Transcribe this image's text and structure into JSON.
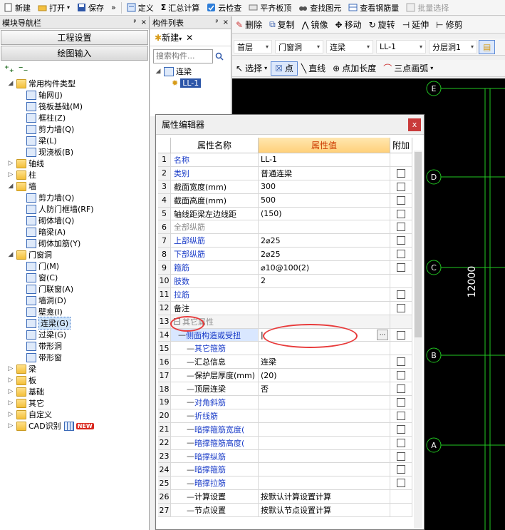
{
  "toolbar": {
    "new": "新建",
    "open": "打开",
    "save": "保存",
    "more": "»",
    "define": "定义",
    "sum": "汇总计算",
    "cloud_check": "云检查",
    "flat_top": "平齐板顶",
    "find_element": "查找图元",
    "view_rebar": "查看钢筋量",
    "batch_select": "批量选择"
  },
  "nav_panel": {
    "title": "模块导航栏",
    "pin": "ᵖ",
    "close": "×",
    "project_settings": "工程设置",
    "drawing_input": "绘图输入"
  },
  "tree": [
    {
      "label": "常用构件类型",
      "expanded": true,
      "folder": true,
      "children": [
        {
          "label": "轴网(J)"
        },
        {
          "label": "筏板基础(M)"
        },
        {
          "label": "框柱(Z)"
        },
        {
          "label": "剪力墙(Q)"
        },
        {
          "label": "梁(L)"
        },
        {
          "label": "现浇板(B)"
        }
      ]
    },
    {
      "label": "轴线",
      "folder": true
    },
    {
      "label": "柱",
      "folder": true
    },
    {
      "label": "墙",
      "expanded": true,
      "folder": true,
      "children": [
        {
          "label": "剪力墙(Q)"
        },
        {
          "label": "人防门框墙(RF)"
        },
        {
          "label": "砌体墙(Q)"
        },
        {
          "label": "暗梁(A)"
        },
        {
          "label": "砌体加筋(Y)"
        }
      ]
    },
    {
      "label": "门窗洞",
      "expanded": true,
      "folder": true,
      "children": [
        {
          "label": "门(M)"
        },
        {
          "label": "窗(C)"
        },
        {
          "label": "门联窗(A)"
        },
        {
          "label": "墙洞(D)"
        },
        {
          "label": "壁龛(I)"
        },
        {
          "label": "连梁(G)",
          "selected": true
        },
        {
          "label": "过梁(G)"
        },
        {
          "label": "带形洞"
        },
        {
          "label": "带形窗"
        }
      ]
    },
    {
      "label": "梁",
      "folder": true
    },
    {
      "label": "板",
      "folder": true
    },
    {
      "label": "基础",
      "folder": true
    },
    {
      "label": "其它",
      "folder": true
    },
    {
      "label": "自定义",
      "folder": true
    },
    {
      "label": "CAD识别",
      "folder": true,
      "new_badge": "NEW"
    }
  ],
  "comp_panel": {
    "title": "构件列表",
    "new": "新建",
    "delete": "✕",
    "search_placeholder": "搜索构件...",
    "tree_root": "连梁",
    "tree_child": "LL-1"
  },
  "right_toolbar_1": {
    "delete": "删除",
    "copy": "复制",
    "mirror": "镜像",
    "move": "移动",
    "rotate": "旋转",
    "extend": "延伸",
    "trim": "修剪"
  },
  "right_toolbar_2": {
    "floor": "首层",
    "type": "门窗洞",
    "sub": "连梁",
    "member": "LL-1",
    "layer": "分层洞1"
  },
  "right_toolbar_3": {
    "select": "选择",
    "point": "点",
    "line": "直线",
    "point_length": "点加长度",
    "three_point_arc": "三点画弧"
  },
  "canvas": {
    "axes": [
      "E",
      "D",
      "C",
      "B",
      "A"
    ],
    "dimension": "12000",
    "colors": {
      "background": "#000000",
      "grid": "#22c722",
      "text": "#ffffff"
    }
  },
  "prop_editor": {
    "title": "属性编辑器",
    "close": "x",
    "headers": {
      "name": "属性名称",
      "value": "属性值",
      "add": "附加"
    },
    "rows": [
      {
        "n": "1",
        "name": "名称",
        "value": "LL-1",
        "style": "blue",
        "chk": false
      },
      {
        "n": "2",
        "name": "类别",
        "value": "普通连梁",
        "style": "blue",
        "chk": true
      },
      {
        "n": "3",
        "name": "截面宽度(mm)",
        "value": "300",
        "style": "",
        "chk": true
      },
      {
        "n": "4",
        "name": "截面高度(mm)",
        "value": "500",
        "style": "",
        "chk": true
      },
      {
        "n": "5",
        "name": "轴线距梁左边线距",
        "value": "(150)",
        "style": "",
        "chk": true
      },
      {
        "n": "6",
        "name": "全部纵筋",
        "value": "",
        "style": "grey",
        "chk": true
      },
      {
        "n": "7",
        "name": "上部纵筋",
        "value": "2⌀25",
        "style": "blue",
        "chk": true
      },
      {
        "n": "8",
        "name": "下部纵筋",
        "value": "2⌀25",
        "style": "blue",
        "chk": true
      },
      {
        "n": "9",
        "name": "箍筋",
        "value": "⌀10@100(2)",
        "style": "blue",
        "chk": true
      },
      {
        "n": "10",
        "name": "肢数",
        "value": "2",
        "style": "blue",
        "chk": false
      },
      {
        "n": "11",
        "name": "拉筋",
        "value": "",
        "style": "blue",
        "chk": true
      },
      {
        "n": "12",
        "name": "备注",
        "value": "",
        "style": "",
        "chk": true
      },
      {
        "n": "13",
        "name": "其它属性",
        "value": "",
        "style": "grey",
        "group": true,
        "chk": false
      },
      {
        "n": "14",
        "name": "侧面构造或受扭",
        "value": "",
        "style": "blue",
        "current": true,
        "chk": true,
        "indent": 1
      },
      {
        "n": "15",
        "name": "其它箍筋",
        "value": "",
        "style": "blue",
        "chk": false,
        "indent": 2
      },
      {
        "n": "16",
        "name": "汇总信息",
        "value": "连梁",
        "style": "",
        "chk": true,
        "indent": 2
      },
      {
        "n": "17",
        "name": "保护层厚度(mm)",
        "value": "(20)",
        "style": "",
        "chk": true,
        "indent": 2
      },
      {
        "n": "18",
        "name": "顶层连梁",
        "value": "否",
        "style": "",
        "chk": true,
        "indent": 2
      },
      {
        "n": "19",
        "name": "对角斜筋",
        "value": "",
        "style": "blue",
        "chk": true,
        "indent": 2
      },
      {
        "n": "20",
        "name": "折线筋",
        "value": "",
        "style": "blue",
        "chk": true,
        "indent": 2
      },
      {
        "n": "21",
        "name": "暗撑箍筋宽度(",
        "value": "",
        "style": "blue",
        "chk": true,
        "indent": 2
      },
      {
        "n": "22",
        "name": "暗撑箍筋高度(",
        "value": "",
        "style": "blue",
        "chk": true,
        "indent": 2
      },
      {
        "n": "23",
        "name": "暗撑纵筋",
        "value": "",
        "style": "blue",
        "chk": true,
        "indent": 2
      },
      {
        "n": "24",
        "name": "暗撑箍筋",
        "value": "",
        "style": "blue",
        "chk": true,
        "indent": 2
      },
      {
        "n": "25",
        "name": "暗撑拉筋",
        "value": "",
        "style": "blue",
        "chk": true,
        "indent": 2
      },
      {
        "n": "26",
        "name": "计算设置",
        "value": "按默认计算设置计算",
        "style": "",
        "chk": false,
        "indent": 2
      },
      {
        "n": "27",
        "name": "节点设置",
        "value": "按默认节点设置计算",
        "style": "",
        "chk": false,
        "indent": 2
      }
    ]
  }
}
